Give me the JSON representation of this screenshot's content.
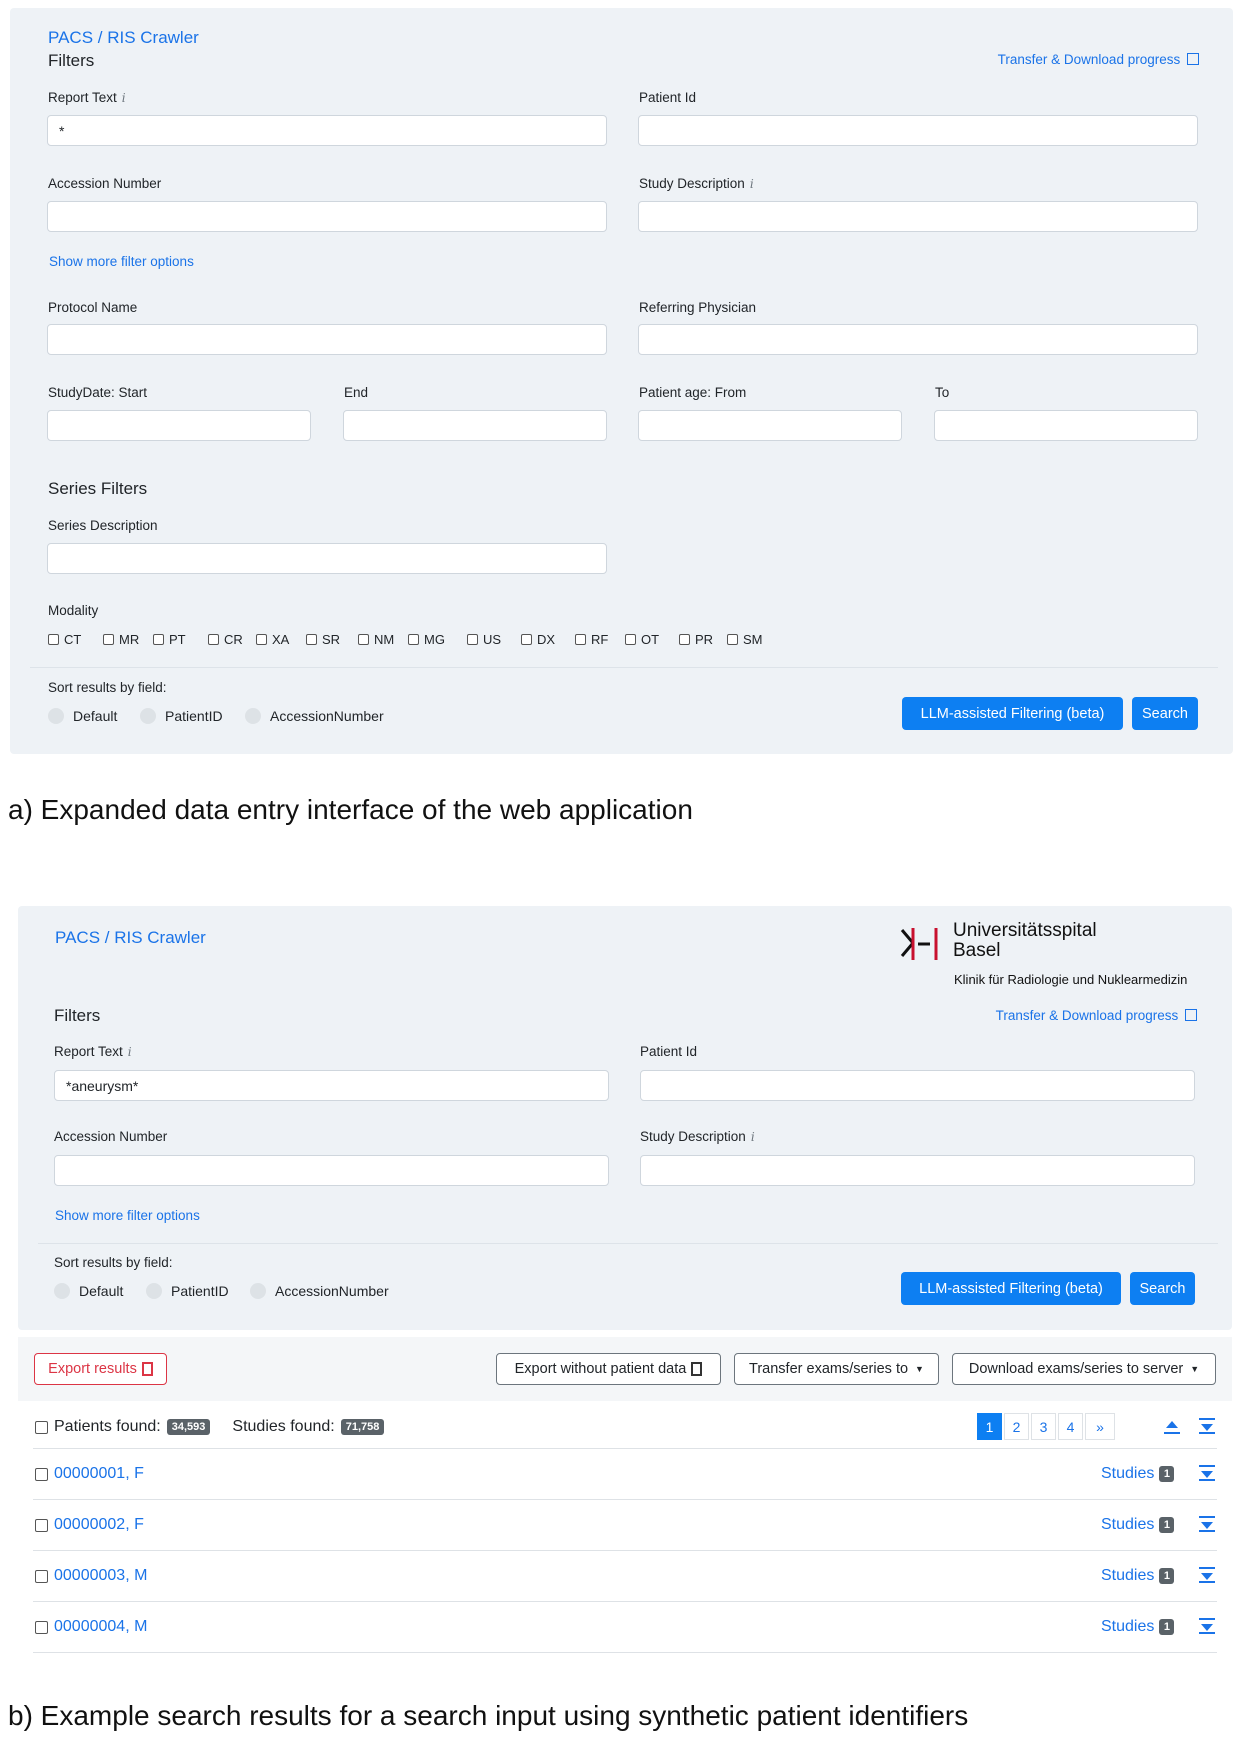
{
  "panel_a": {
    "app_title": "PACS / RIS Crawler",
    "filters_heading": "Filters",
    "transfer_link": "Transfer & Download progress",
    "report_text_label": "Report Text",
    "report_text_value": "*",
    "patient_id_label": "Patient Id",
    "accession_label": "Accession Number",
    "study_desc_label": "Study Description",
    "show_more": "Show more filter options",
    "protocol_label": "Protocol Name",
    "referring_label": "Referring Physician",
    "study_date_start_label": "StudyDate: Start",
    "end_label": "End",
    "patient_age_from_label": "Patient age: From",
    "to_label": "To",
    "series_heading": "Series Filters",
    "series_desc_label": "Series Description",
    "modality_label": "Modality",
    "modalities": [
      "CT",
      "MR",
      "PT",
      "CR",
      "XA",
      "SR",
      "NM",
      "MG",
      "US",
      "DX",
      "RF",
      "OT",
      "PR",
      "SM"
    ],
    "sort_label": "Sort results by field:",
    "sort_options": [
      "Default",
      "PatientID",
      "AccessionNumber"
    ],
    "llm_button": "LLM-assisted Filtering (beta)",
    "search_button": "Search"
  },
  "caption_a": "a) Expanded data entry interface of the web application",
  "panel_b": {
    "app_title": "PACS / RIS Crawler",
    "logo_line1": "Universitätsspital",
    "logo_line2": "Basel",
    "logo_sub": "Klinik für Radiologie und Nuklearmedizin",
    "filters_heading": "Filters",
    "transfer_link": "Transfer & Download progress",
    "report_text_label": "Report Text",
    "report_text_value": "*aneurysm*",
    "patient_id_label": "Patient Id",
    "accession_label": "Accession Number",
    "study_desc_label": "Study Description",
    "show_more": "Show more filter options",
    "sort_label": "Sort results by field:",
    "sort_options": [
      "Default",
      "PatientID",
      "AccessionNumber"
    ],
    "llm_button": "LLM-assisted Filtering (beta)",
    "search_button": "Search"
  },
  "results": {
    "export_results": "Export results",
    "export_without": "Export without patient data",
    "transfer_dropdown": "Transfer exams/series to",
    "download_dropdown": "Download exams/series to server",
    "patients_found_label": "Patients found:",
    "patients_found_count": "34,593",
    "studies_found_label": "Studies found:",
    "studies_found_count": "71,758",
    "pages": [
      "1",
      "2",
      "3",
      "4",
      "»"
    ],
    "rows": [
      {
        "name": "00000001, F",
        "studies_label": "Studies",
        "studies_count": "1"
      },
      {
        "name": "00000002, F",
        "studies_label": "Studies",
        "studies_count": "1"
      },
      {
        "name": "00000003, M",
        "studies_label": "Studies",
        "studies_count": "1"
      },
      {
        "name": "00000004, M",
        "studies_label": "Studies",
        "studies_count": "1"
      }
    ]
  },
  "caption_b": "b) Example search results for a search input using synthetic patient identifiers",
  "colors": {
    "primary": "#0d7ff2",
    "link": "#1a73e8",
    "panel": "#eef2f6",
    "danger": "#dc3545",
    "brand_red": "#c8102e"
  }
}
